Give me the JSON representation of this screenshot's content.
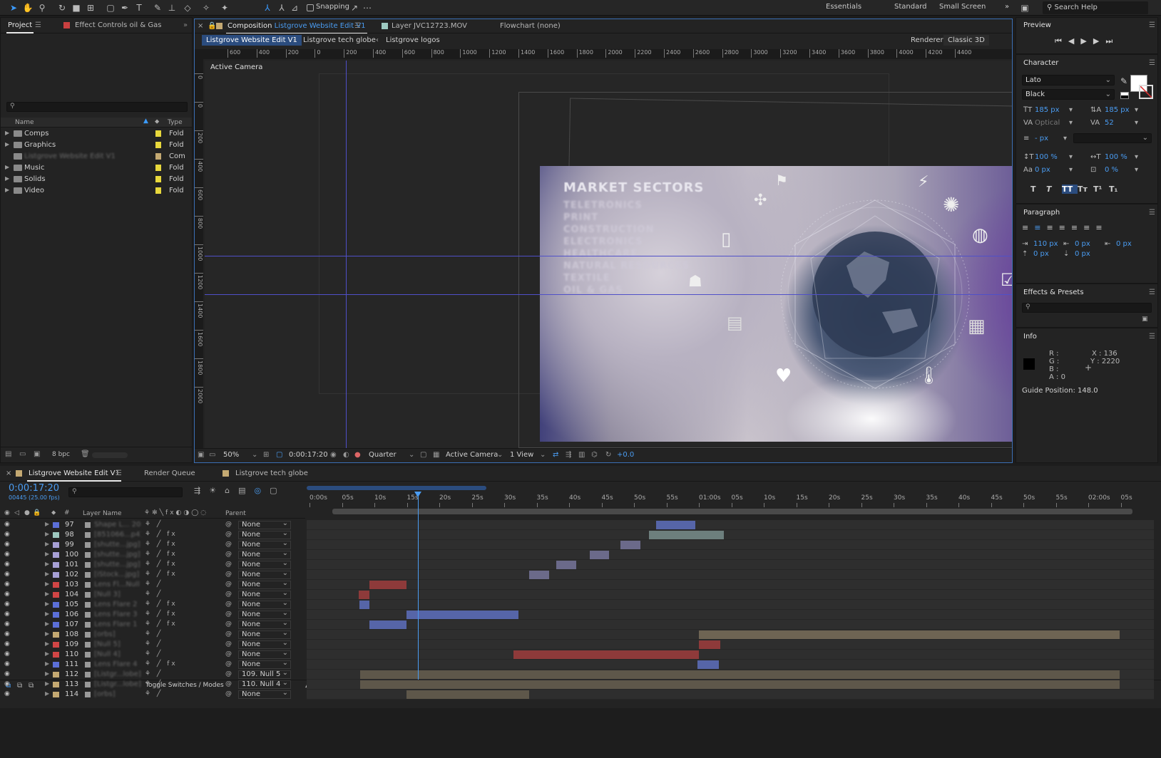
{
  "toolbar": {
    "snapping_label": "Snapping",
    "workspaces": [
      "Essentials",
      "Standard",
      "Small Screen"
    ],
    "more": "»",
    "search_placeholder": "Search Help"
  },
  "project_panel": {
    "tabs": [
      "Project",
      "Effect Controls oil & Gas"
    ],
    "columns": {
      "name": "Name",
      "type": "Type"
    },
    "items": [
      {
        "name": "Comps",
        "type": "Fold",
        "color": "#e8d83c"
      },
      {
        "name": "Graphics",
        "type": "Fold",
        "color": "#e8d83c"
      },
      {
        "name": "Listgrove Website Edit V1",
        "type": "Com",
        "color": "#c4a972"
      },
      {
        "name": "Music",
        "type": "Fold",
        "color": "#e8d83c"
      },
      {
        "name": "Solids",
        "type": "Fold",
        "color": "#e8d83c"
      },
      {
        "name": "Video",
        "type": "Fold",
        "color": "#e8d83c"
      }
    ],
    "bpc": "8 bpc"
  },
  "composition": {
    "panel_prefix": "Composition",
    "panel_name": "Listgrove Website Edit V1",
    "layer_tab": "Layer JVC12723.MOV",
    "flowchart_tab": "Flowchart (none)",
    "breadcrumbs": [
      "Listgrove Website Edit V1",
      "Listgrove tech globe",
      "Listgrove logos"
    ],
    "renderer_label": "Renderer:",
    "renderer_value": "Classic 3D",
    "ruler_labels": [
      "600",
      "400",
      "200",
      "0",
      "200",
      "400",
      "600",
      "800",
      "1000",
      "1200",
      "1400",
      "1600",
      "1800",
      "2000",
      "2200",
      "2400",
      "2600",
      "2800",
      "3000",
      "3200",
      "3400",
      "3600",
      "3800",
      "4000",
      "4200",
      "4400"
    ],
    "vruler_labels": [
      "0",
      "0",
      "200",
      "400",
      "600",
      "800",
      "1000",
      "1200",
      "1400",
      "1600",
      "1800",
      "2000"
    ],
    "camera_label": "Active Camera",
    "market_title": "MARKET SECTORS",
    "market_items": [
      "TELETRONICS",
      "PRINT",
      "CONSTRUCTION",
      "ELECTRONICS",
      "HEALTHCARE",
      "NATURAL RESOURCES",
      "TEXTILE",
      "OIL & GAS"
    ],
    "bottom": {
      "zoom": "50%",
      "timecode": "0:00:17:20",
      "resolution": "Quarter",
      "camera": "Active Camera",
      "views": "1 View",
      "exposure": "+0.0"
    }
  },
  "preview": {
    "title": "Preview"
  },
  "character": {
    "title": "Character",
    "font": "Lato",
    "style": "Black",
    "size": "185 px",
    "leading": "185 px",
    "kerning": "Optical",
    "tracking": "52",
    "stroke": "- px",
    "vscale": "100 %",
    "hscale": "100 %",
    "baseline": "0 px",
    "tsume": "0 %",
    "styles": [
      "T",
      "T",
      "TT",
      "Tт",
      "T¹",
      "T₁"
    ]
  },
  "paragraph": {
    "title": "Paragraph",
    "indent_left": "110 px",
    "indent_first": "0 px",
    "indent_right": "0 px",
    "space_before": "0 px",
    "space_after": "0 px"
  },
  "effects": {
    "title": "Effects & Presets"
  },
  "info": {
    "title": "Info",
    "r": "R :",
    "g": "G :",
    "b": "B :",
    "a": "A : 0",
    "x": "X : 136",
    "y": "Y : 2220",
    "guide": "Guide Position: 148.0"
  },
  "timeline": {
    "tabs": [
      "Listgrove Website Edit V1",
      "Render Queue",
      "Listgrove tech globe"
    ],
    "timecode": "0:00:17:20",
    "frames": "00445 (25.00 fps)",
    "headers": {
      "layer": "Layer Name",
      "parent": "Parent"
    },
    "ruler": [
      "0:00s",
      "05s",
      "10s",
      "15s",
      "20s",
      "25s",
      "30s",
      "35s",
      "40s",
      "45s",
      "50s",
      "55s",
      "01:00s",
      "05s",
      "10s",
      "15s",
      "20s",
      "25s",
      "30s",
      "35s",
      "40s",
      "45s",
      "50s",
      "55s",
      "02:00s",
      "05s"
    ],
    "toggle": "Toggle Switches / Modes",
    "layers": [
      {
        "num": "97",
        "name": "Shape L... 20",
        "color": "#5b6fd8",
        "fx": false,
        "parent": "None",
        "bar": [
          490,
          545
        ],
        "bc": "#5665a8"
      },
      {
        "num": "98",
        "name": "[851066...p4]",
        "color": "#9ec9c0",
        "fx": true,
        "parent": "None",
        "bar": [
          480,
          585
        ],
        "bc": "#6d7f7d"
      },
      {
        "num": "99",
        "name": "[shutte...jpg]",
        "color": "#a7a0d6",
        "fx": true,
        "parent": "None",
        "bar": [
          440,
          468
        ],
        "bc": "#6b6a8a"
      },
      {
        "num": "100",
        "name": "[shutte...jpg]",
        "color": "#a7a0d6",
        "fx": true,
        "parent": "None",
        "bar": [
          397,
          424
        ],
        "bc": "#6b6a8a"
      },
      {
        "num": "101",
        "name": "[shutte...jpg]",
        "color": "#a7a0d6",
        "fx": true,
        "parent": "None",
        "bar": [
          350,
          378
        ],
        "bc": "#6b6a8a"
      },
      {
        "num": "102",
        "name": "[iStock...jpg]",
        "color": "#a7a0d6",
        "fx": true,
        "parent": "None",
        "bar": [
          312,
          340
        ],
        "bc": "#6b6a8a"
      },
      {
        "num": "103",
        "name": "Lens Fl...Null",
        "color": "#d14545",
        "fx": false,
        "parent": "None",
        "bar": [
          88,
          140
        ],
        "bc": "#8e3a3a"
      },
      {
        "num": "104",
        "name": "[Null 3]",
        "color": "#d14545",
        "fx": false,
        "parent": "None",
        "bar": [
          73,
          88
        ],
        "bc": "#8e3a3a"
      },
      {
        "num": "105",
        "name": "Lens Flare 2",
        "color": "#5b6fd8",
        "fx": true,
        "parent": "None",
        "bar": [
          74,
          88
        ],
        "bc": "#5665a8"
      },
      {
        "num": "106",
        "name": "Lens Flare 3",
        "color": "#5b6fd8",
        "fx": true,
        "parent": "None",
        "bar": [
          140,
          297
        ],
        "bc": "#5665a8"
      },
      {
        "num": "107",
        "name": "Lens Flare 1",
        "color": "#5b6fd8",
        "fx": true,
        "parent": "None",
        "bar": [
          88,
          140
        ],
        "bc": "#5665a8"
      },
      {
        "num": "108",
        "name": "[orbs]",
        "color": "#c4a972",
        "fx": false,
        "parent": "None",
        "bar": [
          550,
          1140
        ],
        "bc": "#6e6453"
      },
      {
        "num": "109",
        "name": "[Null 5]",
        "color": "#d14545",
        "fx": false,
        "parent": "None",
        "bar": [
          550,
          580
        ],
        "bc": "#8e3a3a"
      },
      {
        "num": "110",
        "name": "[Null 4]",
        "color": "#d14545",
        "fx": false,
        "parent": "None",
        "bar": [
          290,
          550
        ],
        "bc": "#8e3a3a"
      },
      {
        "num": "111",
        "name": "Lens Flare 4",
        "color": "#5b6fd8",
        "fx": true,
        "parent": "None",
        "bar": [
          548,
          578
        ],
        "bc": "#5665a8"
      },
      {
        "num": "112",
        "name": "[Listgr...lobe]",
        "color": "#c4a972",
        "fx": false,
        "parent": "109. Null 5",
        "bar": [
          75,
          1140
        ],
        "bc": "#5e574a"
      },
      {
        "num": "113",
        "name": "[Listgr...lobe]",
        "color": "#c4a972",
        "fx": false,
        "parent": "110. Null 4",
        "bar": [
          75,
          1140
        ],
        "bc": "#5e574a"
      },
      {
        "num": "114",
        "name": "[orbs]",
        "color": "#c4a972",
        "fx": false,
        "parent": "None",
        "bar": [
          140,
          312
        ],
        "bc": "#5e574a"
      }
    ]
  }
}
